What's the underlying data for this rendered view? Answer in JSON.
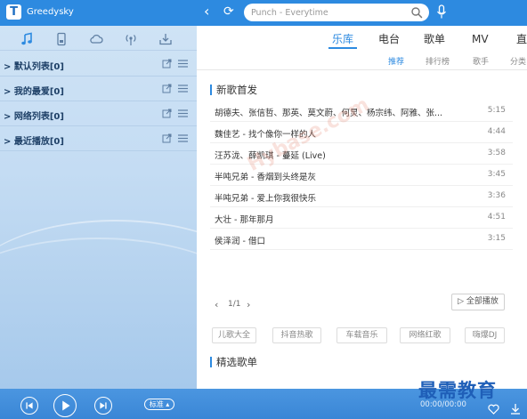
{
  "app": {
    "name": "Greedysky",
    "logo_letter": "T"
  },
  "search": {
    "placeholder": "Punch - Everytime"
  },
  "sidebar": {
    "playlists": [
      {
        "label": "> 默认列表[0]"
      },
      {
        "label": "> 我的最爱[0]"
      },
      {
        "label": "> 网络列表[0]"
      },
      {
        "label": "> 最近播放[0]"
      }
    ]
  },
  "categories": [
    "乐库",
    "电台",
    "歌单",
    "MV",
    "直"
  ],
  "sub_tabs": [
    "推荐",
    "排行榜",
    "歌手",
    "分类"
  ],
  "new_songs": {
    "title": "新歌首发",
    "songs": [
      {
        "title": "胡德夫、张信哲、那英、莫文蔚、何炅、杨宗纬、阿雅、张...",
        "duration": "5:15"
      },
      {
        "title": "魏佳艺 - 找个像你一样的人",
        "duration": "4:44"
      },
      {
        "title": "汪苏泷、薛凯琪 - 蔓延 (Live)",
        "duration": "3:58"
      },
      {
        "title": "半吨兄弟 - 香烟到头终是灰",
        "duration": "3:45"
      },
      {
        "title": "半吨兄弟 - 爱上你我很快乐",
        "duration": "3:36"
      },
      {
        "title": "大壮 - 那年那月",
        "duration": "4:51"
      },
      {
        "title": "侯泽润 - 借口",
        "duration": "3:15"
      }
    ]
  },
  "pager": {
    "prev": "‹",
    "text": "1/1",
    "next": "›",
    "play_all": "▷ 全部播放"
  },
  "tags": [
    "儿歌大全",
    "抖音热歌",
    "车载音乐",
    "网络红歌",
    "嗨爆DJ"
  ],
  "featured": {
    "title": "精选歌单"
  },
  "player": {
    "mode_label": "标准 ▴",
    "time": "00:00/00:00"
  },
  "watermark": "Hybase.com",
  "brand_mark": "最需教育",
  "colors": {
    "accent": "#2d8ae0",
    "sidebar_bg": "#c4dcf3",
    "player_bg": "#3a86d6"
  }
}
